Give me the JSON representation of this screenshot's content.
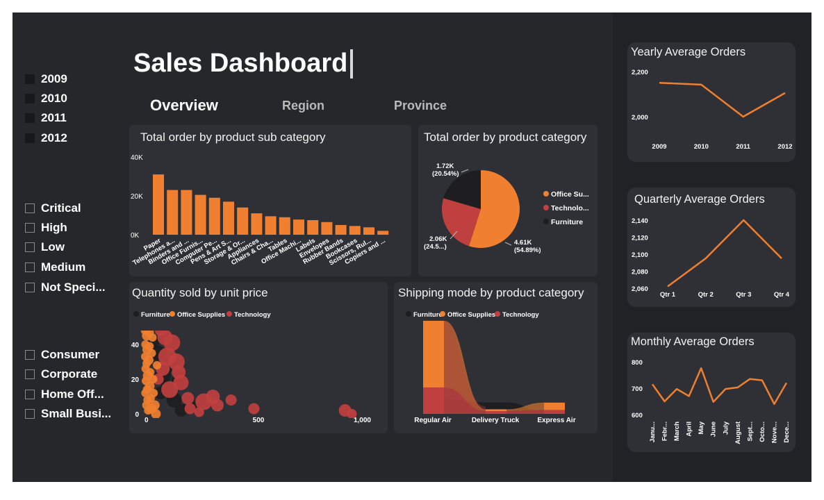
{
  "dashboard": {
    "title": "Sales Dashboard"
  },
  "tabs": [
    {
      "label": "Overview",
      "active": true
    },
    {
      "label": "Region",
      "active": false
    },
    {
      "label": "Province",
      "active": false
    }
  ],
  "slicers": {
    "years": [
      "2009",
      "2010",
      "2011",
      "2012"
    ],
    "priorities": [
      "Critical",
      "High",
      "Low",
      "Medium",
      "Not Speci..."
    ],
    "segments": [
      "Consumer",
      "Corporate",
      "Home Off...",
      "Small Busi..."
    ]
  },
  "colors": {
    "orange": "#f08030",
    "red": "#c0403f",
    "dark": "#1e1e20",
    "panel": "#2e3035",
    "background": "#25272b",
    "axis_text": "#ffffff"
  },
  "chart_data": [
    {
      "id": "subcategory",
      "type": "bar",
      "title": "Total order by product sub category",
      "categories": [
        "Paper",
        "Telephones a...",
        "Binders and ...",
        "Office Furnis...",
        "Computer Pe...",
        "Pens & Art S...",
        "Storage & Or...",
        "Appliances",
        "Chairs & Cha...",
        "Tables",
        "Office Machi...",
        "Labels",
        "Envelopes",
        "Rubber Bands",
        "Bookcases",
        "Scissors, Rul...",
        "Copiers and ..."
      ],
      "values": [
        31000,
        23000,
        23000,
        20500,
        19000,
        17000,
        14000,
        11000,
        9500,
        9000,
        7800,
        7500,
        6500,
        5000,
        4500,
        3800,
        2000
      ],
      "y_ticks": [
        "40K",
        "20K",
        "0K"
      ],
      "ylim": [
        0,
        40000
      ],
      "color": "#f08030"
    },
    {
      "id": "category",
      "type": "pie",
      "title": "Total order by product category",
      "slices": [
        {
          "name": "Office Su...",
          "value": 4610,
          "percent": 54.89,
          "color": "#f08030",
          "label": "4.61K",
          "pct_label": "(54.89%)"
        },
        {
          "name": "Technolo...",
          "value": 2060,
          "percent": 24.57,
          "color": "#c0403f",
          "label": "2.06K",
          "pct_label": "(24.5...)"
        },
        {
          "name": "Furniture",
          "value": 1720,
          "percent": 20.54,
          "color": "#1e1e20",
          "label": "1.72K",
          "pct_label": "(20.54%)"
        }
      ]
    },
    {
      "id": "scatter",
      "type": "scatter",
      "title": "Quantity sold by unit price",
      "legend": [
        "Furniture",
        "Office Supplies",
        "Technology"
      ],
      "x_ticks": [
        "0",
        "500",
        "1,000"
      ],
      "y_ticks": [
        "40",
        "20",
        "0"
      ],
      "xlim": [
        0,
        1000
      ],
      "ylim": [
        0,
        50
      ],
      "series": [
        {
          "name": "Office Supplies",
          "color": "#f08030",
          "points": [
            [
              2,
              48,
              6
            ],
            [
              4,
              40,
              6
            ],
            [
              3,
              33,
              6
            ],
            [
              5,
              26,
              6
            ],
            [
              6,
              19,
              6
            ],
            [
              4,
              12,
              6
            ],
            [
              8,
              5,
              6
            ],
            [
              10,
              45,
              7
            ],
            [
              12,
              37,
              7
            ],
            [
              9,
              29,
              6
            ],
            [
              14,
              22,
              7
            ],
            [
              11,
              14,
              6
            ],
            [
              13,
              8,
              6
            ],
            [
              16,
              2,
              6
            ],
            [
              20,
              47,
              7
            ],
            [
              22,
              39,
              6
            ],
            [
              18,
              31,
              7
            ],
            [
              25,
              24,
              6
            ],
            [
              23,
              16,
              7
            ],
            [
              27,
              9,
              6
            ],
            [
              30,
              3,
              7
            ],
            [
              35,
              44,
              6
            ],
            [
              32,
              35,
              6
            ],
            [
              38,
              20,
              6
            ],
            [
              40,
              12,
              6
            ],
            [
              45,
              5,
              7
            ],
            [
              50,
              0,
              7
            ],
            [
              55,
              28,
              6
            ]
          ]
        },
        {
          "name": "Furniture",
          "color": "#1e1e20",
          "points": [
            [
              40,
              42,
              9
            ],
            [
              60,
              35,
              11
            ],
            [
              80,
              22,
              12
            ],
            [
              100,
              15,
              10
            ],
            [
              130,
              8,
              11
            ],
            [
              160,
              2,
              9
            ],
            [
              70,
              12,
              9
            ],
            [
              110,
              28,
              10
            ],
            [
              150,
              20,
              10
            ],
            [
              200,
              5,
              9
            ]
          ]
        },
        {
          "name": "Technology",
          "color": "#c0403f",
          "points": [
            [
              70,
              48,
              8
            ],
            [
              90,
              44,
              11
            ],
            [
              120,
              41,
              12
            ],
            [
              100,
              33,
              13
            ],
            [
              140,
              30,
              12
            ],
            [
              80,
              26,
              10
            ],
            [
              160,
              18,
              11
            ],
            [
              110,
              14,
              12
            ],
            [
              190,
              9,
              9
            ],
            [
              260,
              7,
              12
            ],
            [
              300,
              10,
              10
            ],
            [
              320,
              5,
              9
            ],
            [
              380,
              8,
              8
            ],
            [
              480,
              3,
              8
            ],
            [
              880,
              2,
              9
            ],
            [
              910,
              0,
              7
            ],
            [
              200,
              3,
              8
            ],
            [
              240,
              1,
              7
            ],
            [
              150,
              24,
              10
            ],
            [
              60,
              20,
              8
            ]
          ]
        }
      ]
    },
    {
      "id": "shipping",
      "type": "area",
      "title": "Shipping mode by product  category",
      "legend": [
        "Furniture",
        "Office Supplies",
        "Technology"
      ],
      "categories": [
        "Regular Air",
        "Delivery Truck",
        "Express Air"
      ],
      "series": [
        {
          "name": "Office Supplies",
          "color": "#f08030",
          "values": [
            2900,
            80,
            320
          ]
        },
        {
          "name": "Technology",
          "color": "#c0403f",
          "values": [
            1150,
            120,
            170
          ]
        },
        {
          "name": "Furniture",
          "color": "#1e1e20",
          "values": [
            650,
            500,
            110
          ]
        }
      ]
    },
    {
      "id": "yearly",
      "type": "line",
      "title": "Yearly Average Orders",
      "categories": [
        "2009",
        "2010",
        "2011",
        "2012"
      ],
      "values": [
        2150,
        2142,
        2000,
        2105
      ],
      "y_ticks": [
        {
          "label": "2,200",
          "value": 2200
        },
        {
          "label": "2,000",
          "value": 2000
        }
      ],
      "ylim": [
        2000,
        2200
      ],
      "color": "#f08030"
    },
    {
      "id": "quarterly",
      "type": "line",
      "title": "Quarterly Average Orders",
      "categories": [
        "Qtr 1",
        "Qtr 2",
        "Qtr 3",
        "Qtr 4"
      ],
      "values": [
        2062,
        2095,
        2140,
        2095
      ],
      "y_ticks": [
        {
          "label": "2,140",
          "value": 2140
        },
        {
          "label": "2,120",
          "value": 2120
        },
        {
          "label": "2,100",
          "value": 2100
        },
        {
          "label": "2,080",
          "value": 2080
        },
        {
          "label": "2,060",
          "value": 2060
        }
      ],
      "ylim": [
        2060,
        2140
      ],
      "color": "#f08030"
    },
    {
      "id": "monthly",
      "type": "line",
      "title": "Monthly Average Orders",
      "categories": [
        "Janu...",
        "Febr...",
        "March",
        "April",
        "May",
        "June",
        "July",
        "August",
        "Sept...",
        "Octo...",
        "Nove...",
        "Dece..."
      ],
      "values": [
        715,
        650,
        697,
        670,
        776,
        648,
        697,
        703,
        735,
        730,
        640,
        720
      ],
      "y_ticks": [
        {
          "label": "800",
          "value": 800
        },
        {
          "label": "700",
          "value": 700
        },
        {
          "label": "600",
          "value": 600
        }
      ],
      "ylim": [
        600,
        800
      ],
      "color": "#f08030"
    }
  ]
}
